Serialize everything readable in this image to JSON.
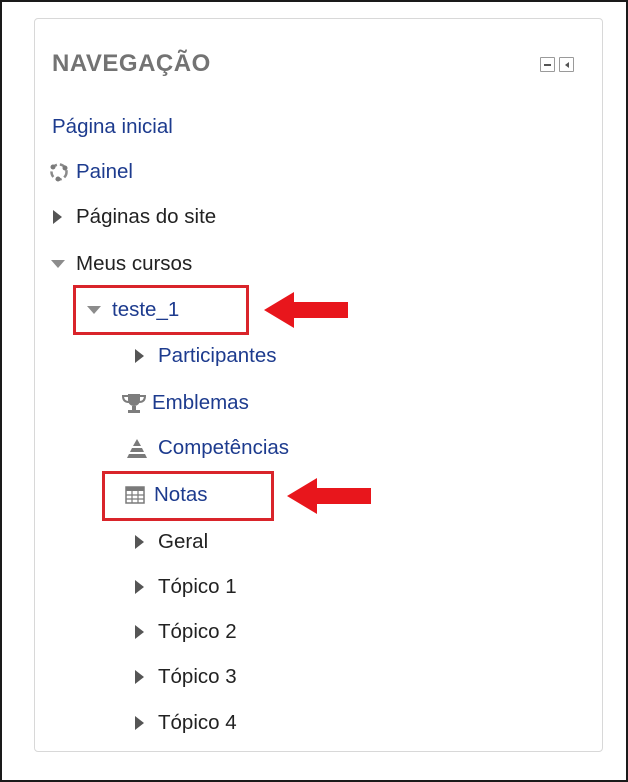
{
  "block": {
    "title": "NAVEGAÇÃO",
    "controls": [
      "minimize-icon",
      "dock-icon"
    ]
  },
  "nav": {
    "home": "Página inicial",
    "dashboard": "Painel",
    "site_pages": "Páginas do site",
    "my_courses": "Meus cursos",
    "course": "teste_1",
    "participants": "Participantes",
    "badges": "Emblemas",
    "competencies": "Competências",
    "grades": "Notas",
    "sections": [
      "Geral",
      "Tópico 1",
      "Tópico 2",
      "Tópico 3",
      "Tópico 4"
    ]
  },
  "annotation": {
    "highlight_color": "#d9242a",
    "link_color": "#1d3b8e"
  }
}
